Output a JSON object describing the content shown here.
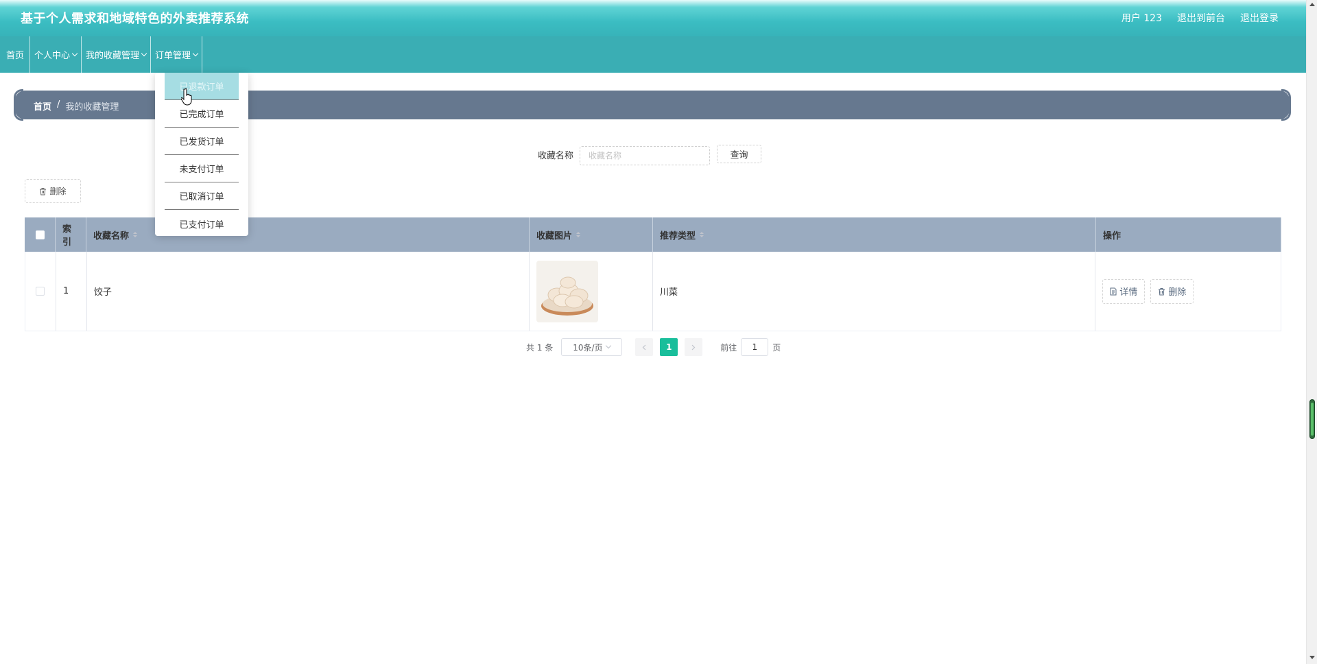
{
  "header": {
    "title": "基于个人需求和地域特色的外卖推荐系统",
    "user": "用户 123",
    "exit_front": "退出到前台",
    "logout": "退出登录"
  },
  "nav": {
    "items": [
      {
        "label": "首页"
      },
      {
        "label": "个人中心"
      },
      {
        "label": "我的收藏管理"
      },
      {
        "label": "订单管理"
      }
    ]
  },
  "order_menu": {
    "items": [
      "已退款订单",
      "已完成订单",
      "已发货订单",
      "未支付订单",
      "已取消订单",
      "已支付订单"
    ],
    "hovered_index": 0
  },
  "breadcrumb": {
    "home": "首页",
    "separator": "/",
    "current": "我的收藏管理"
  },
  "search": {
    "label": "收藏名称",
    "placeholder": "收藏名称",
    "value": "",
    "button": "查询"
  },
  "toolbar": {
    "delete_label": "删除"
  },
  "table": {
    "headers": {
      "index": "索引",
      "name": "收藏名称",
      "image": "收藏图片",
      "type": "推荐类型",
      "ops": "操作"
    },
    "rows": [
      {
        "index": "1",
        "name": "饺子",
        "type": "川菜",
        "image_icon": "dumplings-photo"
      }
    ],
    "detail_label": "详情",
    "delete_label": "删除"
  },
  "pagination": {
    "total_text": "共 1 条",
    "page_size": "10条/页",
    "current_page": "1",
    "goto_label": "前往",
    "goto_value": "1",
    "page_suffix": "页"
  },
  "colors": {
    "header": "#37b3b9",
    "nav": "#3aaeb4",
    "breadcrumb_bar": "#66788f",
    "table_header": "#9aabc0",
    "page_active": "#19be9b",
    "dropdown_hover": "#a6dde3"
  }
}
